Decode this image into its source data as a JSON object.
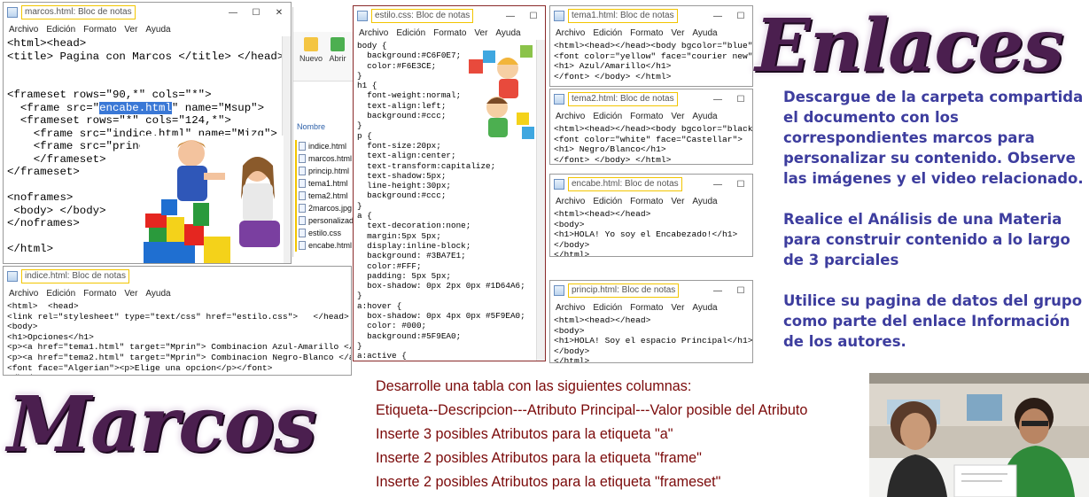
{
  "menus": {
    "archivo": "Archivo",
    "edicion": "Edición",
    "formato": "Formato",
    "ver": "Ver",
    "ayuda": "Ayuda"
  },
  "windows": {
    "marcos": {
      "title": "marcos.html: Bloc de notas",
      "code_before": "<html><head>\n<title> Pagina con Marcos </title> </head>\n\n\n<frameset rows=\"90,*\" cols=\"*\">\n  <frame src=\"",
      "code_highlight": "encabe.html",
      "code_after": "\" name=\"Msup\">\n  <frameset rows=\"*\" cols=\"124,*\">\n    <frame src=\"indice.html\" name=\"Mizq\">\n    <frame src=\"princip.html\" name=\"Mprin\">\n    </frameset>\n</frameset>\n\n<noframes>\n <body> </body>\n</noframes>\n\n</html>"
    },
    "estilo": {
      "title": "estilo.css: Bloc de notas",
      "code": "body {\n  background:#C6F0E7;\n  color:#F6E3CE;\n}\nh1 {\n  font-weight:normal;\n  text-align:left;\n  background:#ccc;\n}\np {\n  font-size:20px;\n  text-align:center;\n  text-transform:capitalize;\n  text-shadow:5px;\n  line-height:30px;\n  background:#ccc;\n}\na {\n  text-decoration:none;\n  margin:5px 5px;\n  display:inline-block;\n  background: #3BA7E1;\n  color:#FFF;\n  padding: 5px 5px;\n  box-shadow: 0px 2px 0px #1D64A6;\n}\na:hover {\n  box-shadow: 0px 4px 0px #5F9EA0;\n  color: #000;\n  background:#5F9EA0;\n}\na:active {\n  box-shadow:none;\n}"
    },
    "tema1": {
      "title": "tema1.html: Bloc de notas",
      "code": "<html><head></head><body bgcolor=\"blue\">\n<font color=\"yellow\" face=\"courier new\">\n<h1> Azul/Amarillo</h1>\n</font> </body> </html>"
    },
    "tema2": {
      "title": "tema2.html: Bloc de notas",
      "code": "<html><head></head><body bgcolor=\"black\">\n<font color=\"white\" face=\"Castellar\">\n<h1> Negro/Blanco</h1>\n</font> </body> </html>"
    },
    "encabe": {
      "title": "encabe.html: Bloc de notas",
      "code": "<html><head></head>\n<body>\n<h1>HOLA! Yo soy el Encabezado!</h1>\n</body>\n</html>"
    },
    "princip": {
      "title": "princip.html: Bloc de notas",
      "code": "<html><head></head>\n<body>\n<h1>HOLA! Soy el espacio Principal</h1>\n</body>\n</html>"
    },
    "indice": {
      "title": "indice.html: Bloc de notas",
      "code": "<html>  <head>\n<link rel=\"stylesheet\" type=\"text/css\" href=\"estilo.css\">   </head>\n<body>\n<h1>Opciones</h1>\n<p><a href=\"tema1.html\" target=\"Mprin\"> Combinacion Azul-Amarillo </a> </p>\n<p><a href=\"tema2.html\" target=\"Mprin\"> Combinacion Negro-Blanco </a> </p>\n<font face=\"Algerian\"><p>Elige una opcion</p></font>\n</body>"
    }
  },
  "explorer": {
    "btn_nuevo": "Nuevo",
    "btn_abrir": "Abrir",
    "column_header": "Nombre",
    "files": [
      "indice.html",
      "marcos.html",
      "princip.html",
      "tema1.html",
      "tema2.html",
      "2marcos.jpg",
      "personalizado",
      "estilo.css",
      "encabe.html"
    ]
  },
  "enlaces": {
    "title": "Enlaces",
    "paragraph1": "Descargue de la carpeta compartida el documento con los correspondientes marcos para personalizar su contenido. Observe las imágenes y el video relacionado.",
    "paragraph2": "Realice el Análisis de una Materia para construir contenido a lo largo de 3 parciales",
    "paragraph3": "Utilice su pagina de datos del grupo como parte del enlace Información de los autores."
  },
  "marcos_section": {
    "title": "Marcos",
    "lines": [
      "Desarrolle una tabla con las siguientes columnas:",
      "Etiqueta--Descripcion---Atributo Principal---Valor posible del Atributo",
      "Inserte 3 posibles Atributos para la etiqueta \"a\"",
      "Inserte 2 posibles Atributos para la etiqueta \"frame\"",
      "Inserte 2 posibles Atributos para la etiqueta \"frameset\""
    ]
  },
  "colors": {
    "title_purple": "#4b1f4f",
    "instruction_blue": "#3d3d9e",
    "instruction_red": "#7b0a0a",
    "window_title_highlight": "#f2c500",
    "selection_blue": "#3a78d6"
  }
}
